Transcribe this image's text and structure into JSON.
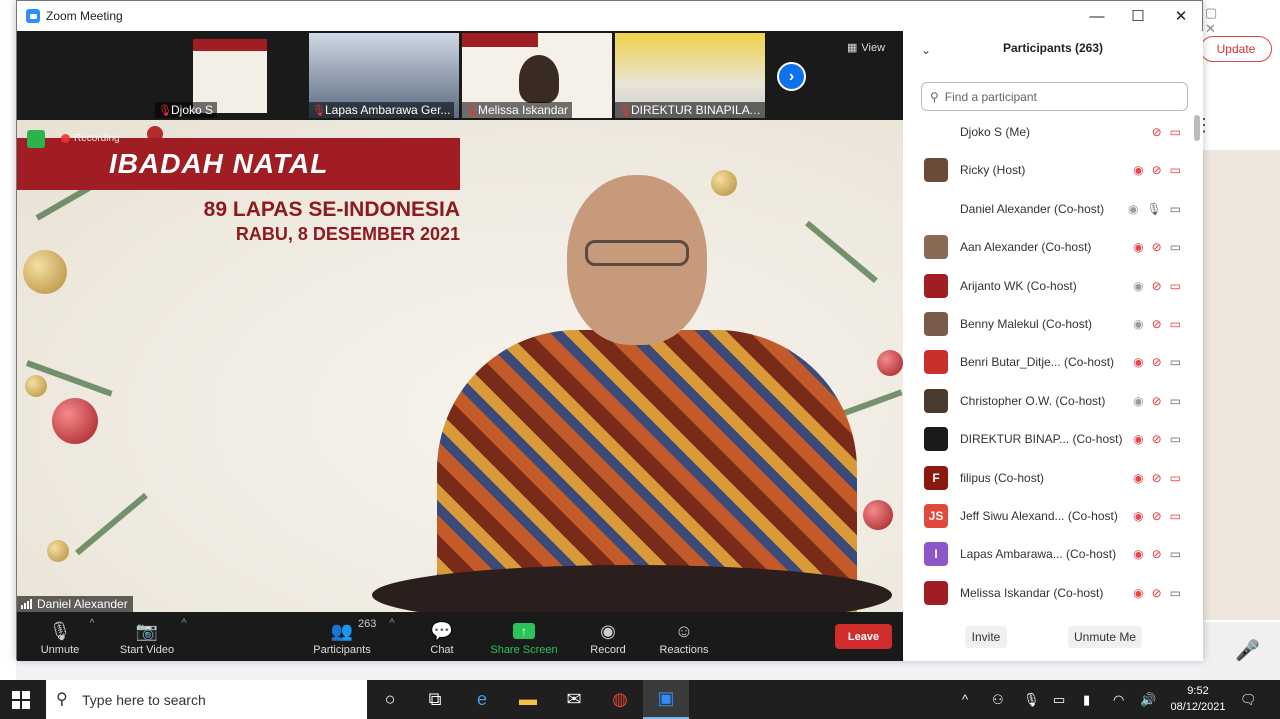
{
  "window": {
    "title": "Zoom Meeting"
  },
  "background_app": {
    "update_label": "Update"
  },
  "thumbnails": [
    {
      "label": "Djoko S"
    },
    {
      "label": "Lapas Ambarawa Ger..."
    },
    {
      "label": "Melissa Iskandar"
    },
    {
      "label": "DIREKTUR BINAPILAT..."
    }
  ],
  "view_label": "View",
  "main_video": {
    "recording_label": "Recording",
    "banner_title": "IBADAH NATAL",
    "banner_line1": "89 LAPAS SE-INDONESIA",
    "banner_line2": "RABU, 8 DESEMBER 2021",
    "speaker_name": "Daniel Alexander"
  },
  "toolbar": {
    "unmute": "Unmute",
    "start_video": "Start Video",
    "participants": "Participants",
    "participant_count": "263",
    "chat": "Chat",
    "share_screen": "Share Screen",
    "record": "Record",
    "reactions": "Reactions",
    "leave": "Leave"
  },
  "panel": {
    "title": "Participants (263)",
    "search_placeholder": "Find a participant",
    "invite": "Invite",
    "unmute_me": "Unmute Me",
    "participants": [
      {
        "name": "Djoko S (Me)",
        "avatar_color": "#ffffff",
        "avatar_text": "",
        "rec": false,
        "mic_on": false,
        "cam_on": false
      },
      {
        "name": "Ricky (Host)",
        "avatar_color": "#6b4a3a",
        "avatar_text": "",
        "rec": true,
        "mic_on": false,
        "cam_on": false
      },
      {
        "name": "Daniel Alexander (Co-host)",
        "avatar_color": "#ffffff",
        "avatar_text": "",
        "rec": false,
        "mic_on": true,
        "cam_on": true
      },
      {
        "name": "Aan Alexander (Co-host)",
        "avatar_color": "#8a6a55",
        "avatar_text": "",
        "rec": true,
        "mic_on": false,
        "cam_on": true
      },
      {
        "name": "Arijanto WK (Co-host)",
        "avatar_color": "#a11d24",
        "avatar_text": "",
        "rec": false,
        "mic_on": false,
        "cam_on": false
      },
      {
        "name": "Benny Malekul (Co-host)",
        "avatar_color": "#7a5a4a",
        "avatar_text": "",
        "rec": false,
        "mic_on": false,
        "cam_on": false
      },
      {
        "name": "Benri Butar_Ditje...   (Co-host)",
        "avatar_color": "#c9302c",
        "avatar_text": "",
        "rec": true,
        "mic_on": false,
        "cam_on": true
      },
      {
        "name": "Christopher O.W. (Co-host)",
        "avatar_color": "#4a3a30",
        "avatar_text": "",
        "rec": false,
        "mic_on": false,
        "cam_on": true
      },
      {
        "name": "DIREKTUR BINAP...   (Co-host)",
        "avatar_color": "#1a1a1a",
        "avatar_text": "",
        "rec": true,
        "mic_on": false,
        "cam_on": true
      },
      {
        "name": "filipus (Co-host)",
        "avatar_color": "#8a1a10",
        "avatar_text": "F",
        "rec": true,
        "mic_on": false,
        "cam_on": false
      },
      {
        "name": "Jeff Siwu Alexand...   (Co-host)",
        "avatar_color": "#e04a3a",
        "avatar_text": "JS",
        "rec": true,
        "mic_on": false,
        "cam_on": false
      },
      {
        "name": "Lapas Ambarawa...   (Co-host)",
        "avatar_color": "#8e57c9",
        "avatar_text": "I",
        "rec": true,
        "mic_on": false,
        "cam_on": true
      },
      {
        "name": "Melissa Iskandar (Co-host)",
        "avatar_color": "#a11d24",
        "avatar_text": "",
        "rec": true,
        "mic_on": false,
        "cam_on": true
      }
    ]
  },
  "taskbar": {
    "search_placeholder": "Type here to search",
    "time": "9:52",
    "date": "08/12/2021"
  }
}
